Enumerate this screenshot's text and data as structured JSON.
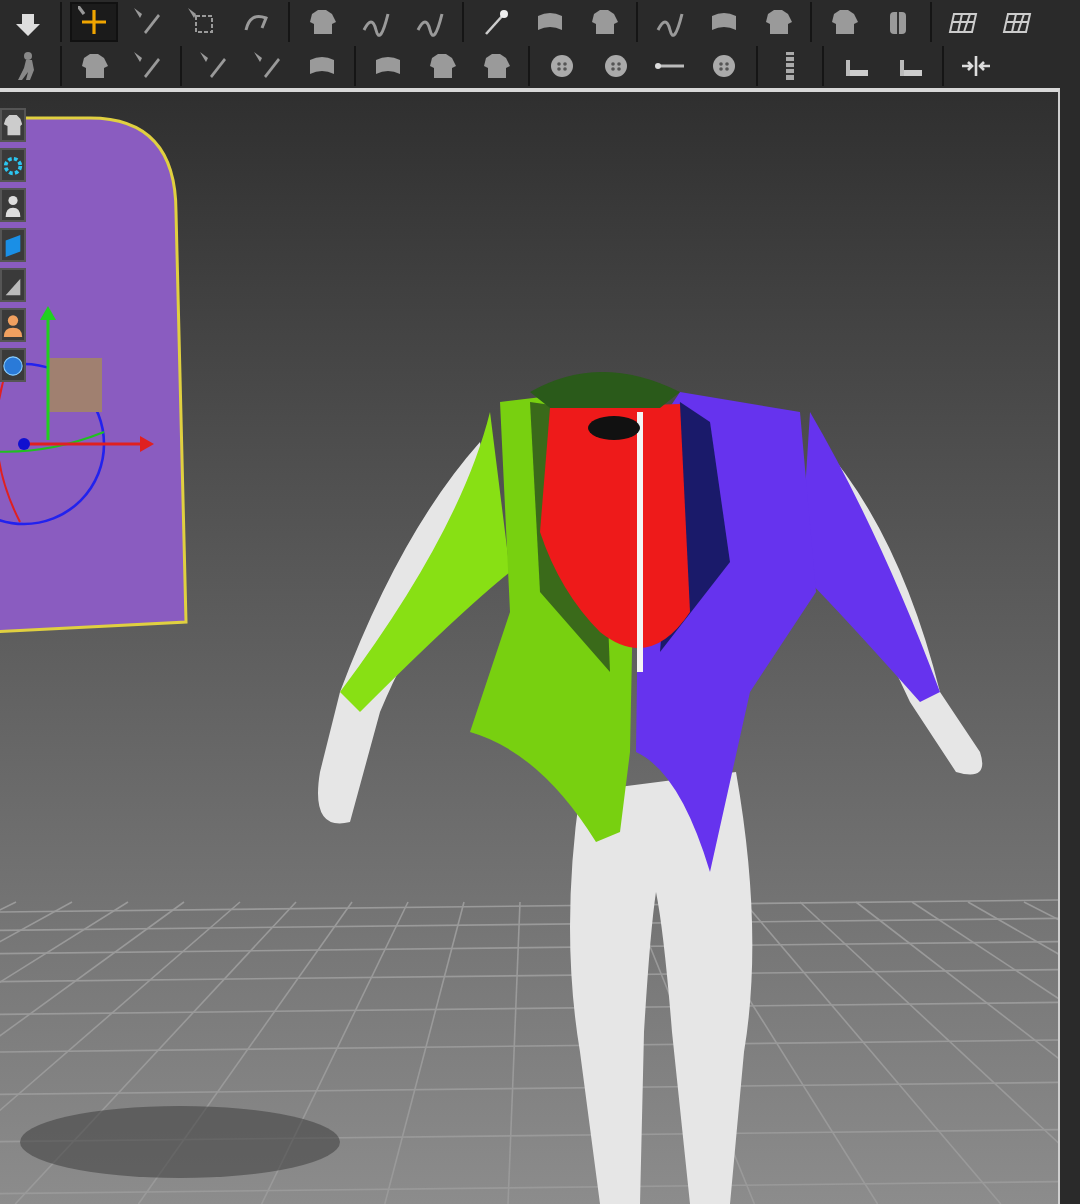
{
  "toolbars": [
    {
      "groups": [
        {
          "tools": [
            {
              "kind": "down",
              "selected": false
            }
          ]
        },
        {
          "tools": [
            {
              "kind": "move",
              "selected": true
            },
            {
              "kind": "pen",
              "selected": false
            },
            {
              "kind": "box",
              "selected": false
            },
            {
              "kind": "curve",
              "selected": false
            }
          ]
        },
        {
          "tools": [
            {
              "kind": "shirt",
              "selected": false
            },
            {
              "kind": "seam",
              "selected": false
            },
            {
              "kind": "seam",
              "selected": false
            }
          ]
        },
        {
          "tools": [
            {
              "kind": "pin",
              "selected": false
            },
            {
              "kind": "cloth",
              "selected": false
            },
            {
              "kind": "shirt",
              "selected": false
            }
          ]
        },
        {
          "tools": [
            {
              "kind": "seam",
              "selected": false
            },
            {
              "kind": "cloth",
              "selected": false
            },
            {
              "kind": "shirt",
              "selected": false
            }
          ]
        },
        {
          "tools": [
            {
              "kind": "shirt",
              "selected": false
            },
            {
              "kind": "cylinder",
              "selected": false
            }
          ]
        },
        {
          "tools": [
            {
              "kind": "grid",
              "selected": false
            },
            {
              "kind": "grid",
              "selected": false
            }
          ]
        }
      ]
    },
    {
      "groups": [
        {
          "tools": [
            {
              "kind": "walk",
              "selected": false
            }
          ]
        },
        {
          "tools": [
            {
              "kind": "shirt",
              "selected": false
            },
            {
              "kind": "pen",
              "selected": false
            }
          ]
        },
        {
          "tools": [
            {
              "kind": "pen",
              "selected": false
            },
            {
              "kind": "pen",
              "selected": false
            },
            {
              "kind": "cloth",
              "selected": false
            }
          ]
        },
        {
          "tools": [
            {
              "kind": "cloth",
              "selected": false
            },
            {
              "kind": "shirt",
              "selected": false
            },
            {
              "kind": "shirt",
              "selected": false
            }
          ]
        },
        {
          "tools": [
            {
              "kind": "button",
              "selected": false
            },
            {
              "kind": "button",
              "selected": false
            },
            {
              "kind": "line",
              "selected": false
            },
            {
              "kind": "button",
              "selected": false
            }
          ]
        },
        {
          "tools": [
            {
              "kind": "zipper",
              "selected": false
            }
          ]
        },
        {
          "tools": [
            {
              "kind": "tape",
              "selected": false
            },
            {
              "kind": "tape",
              "selected": false
            }
          ]
        },
        {
          "tools": [
            {
              "kind": "tack",
              "selected": false
            }
          ]
        }
      ]
    }
  ],
  "side_toolbar": [
    {
      "kind": "shirt"
    },
    {
      "kind": "ring"
    },
    {
      "kind": "person"
    },
    {
      "kind": "book"
    },
    {
      "kind": "shape"
    },
    {
      "kind": "avatar"
    },
    {
      "kind": "globe"
    }
  ]
}
